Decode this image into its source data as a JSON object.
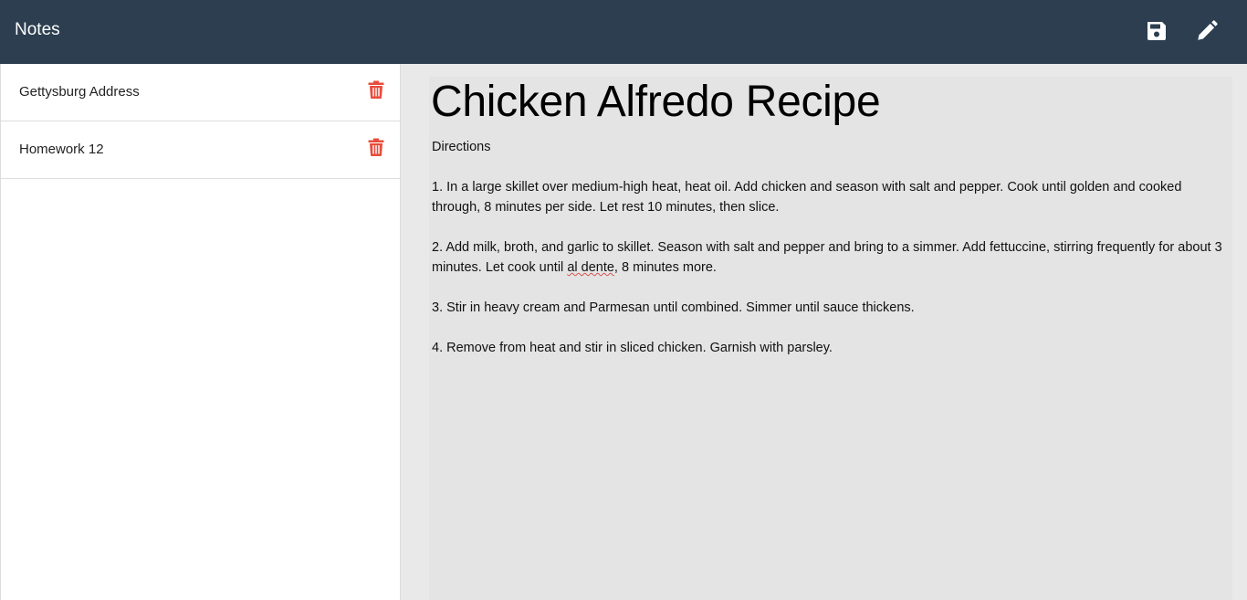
{
  "app": {
    "title": "Notes",
    "icons": {
      "save": "floppy-disk-icon",
      "edit": "pencil-icon",
      "delete": "trash-icon"
    },
    "colors": {
      "navbar": "#2c3e50",
      "delete": "#e74c3c",
      "editor_bg": "#e4e4e4"
    }
  },
  "sidebar": {
    "notes": [
      {
        "title": "Gettysburg Address"
      },
      {
        "title": "Homework 12"
      }
    ]
  },
  "editor": {
    "title": "Chicken Alfredo Recipe",
    "body_intro": "Directions\n\n1. In a large skillet over medium-high heat, heat oil. Add chicken and season with salt and pepper. Cook until golden and cooked through, 8 minutes per side. Let rest 10 minutes, then slice.\n\n2. Add milk, broth, and garlic to skillet. Season with salt and pepper and bring to a simmer. Add fettuccine, stirring frequently for about 3 minutes. Let cook until ",
    "body_misspelled": "al dente",
    "body_rest": ", 8 minutes more.\n\n3. Stir in heavy cream and Parmesan until combined. Simmer until sauce thickens.\n\n4. Remove from heat and stir in sliced chicken. Garnish with parsley."
  }
}
